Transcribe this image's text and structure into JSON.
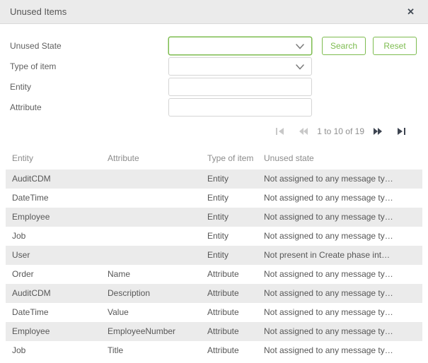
{
  "dialog": {
    "title": "Unused Items"
  },
  "icons": {
    "close": "✕",
    "chevron_down": "⌄",
    "first_page": "|◀",
    "previous_page": "◀◀",
    "next_page": "▶▶",
    "last_page": "▶|"
  },
  "filters": {
    "fields": [
      {
        "label": "Unused State",
        "type": "select",
        "value": "",
        "focused": true
      },
      {
        "label": "Type of item",
        "type": "select",
        "value": "",
        "focused": false
      },
      {
        "label": "Entity",
        "type": "text",
        "value": ""
      },
      {
        "label": "Attribute",
        "type": "text",
        "value": ""
      }
    ],
    "search_label": "Search",
    "reset_label": "Reset"
  },
  "pagination": {
    "range_text": "1 to 10 of 19"
  },
  "table": {
    "columns": [
      "Entity",
      "Attribute",
      "Type of item",
      "Unused state"
    ],
    "rows": [
      [
        "AuditCDM",
        "",
        "Entity",
        "Not assigned to any message ty…"
      ],
      [
        "DateTime",
        "",
        "Entity",
        "Not assigned to any message ty…"
      ],
      [
        "Employee",
        "",
        "Entity",
        "Not assigned to any message ty…"
      ],
      [
        "Job",
        "",
        "Entity",
        "Not assigned to any message ty…"
      ],
      [
        "User",
        "",
        "Entity",
        "Not present in Create phase int…"
      ],
      [
        "Order",
        "Name",
        "Attribute",
        "Not assigned to any message ty…"
      ],
      [
        "AuditCDM",
        "Description",
        "Attribute",
        "Not assigned to any message ty…"
      ],
      [
        "DateTime",
        "Value",
        "Attribute",
        "Not assigned to any message ty…"
      ],
      [
        "Employee",
        "EmployeeNumber",
        "Attribute",
        "Not assigned to any message ty…"
      ],
      [
        "Job",
        "Title",
        "Attribute",
        "Not assigned to any message ty…"
      ]
    ]
  },
  "colors": {
    "accent_green": "#7dbc4f",
    "header_bg": "#ebebeb",
    "row_alt_bg": "#ebebeb"
  }
}
